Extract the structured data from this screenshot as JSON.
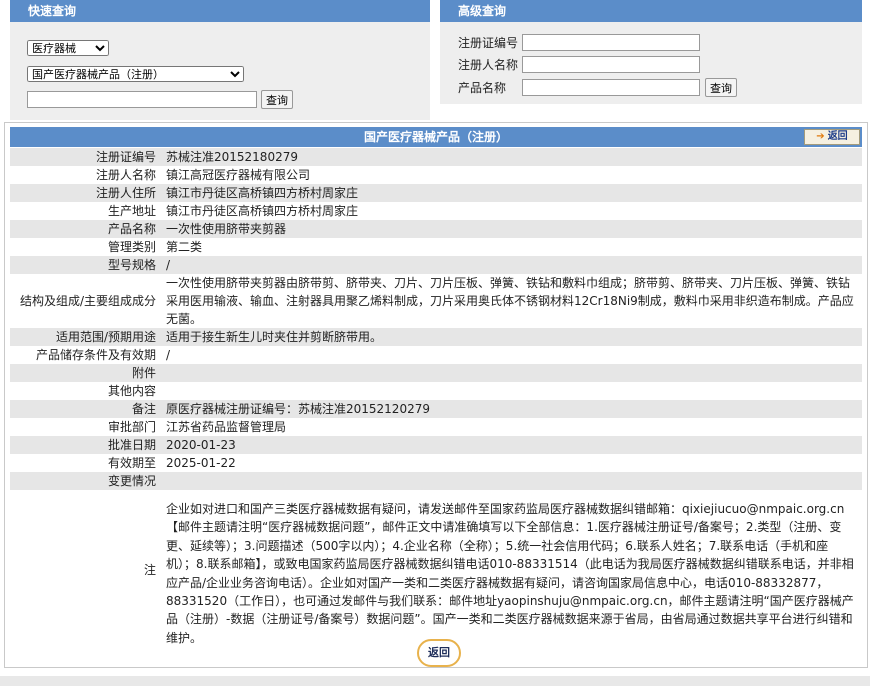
{
  "quick": {
    "title": "快速查询",
    "category_selected": "医疗器械",
    "product_type_selected": "国产医疗器械产品（注册）",
    "search_value": "",
    "query_button": "查询"
  },
  "advanced": {
    "title": "高级查询",
    "reg_no_label": "注册证编号",
    "registrant_label": "注册人名称",
    "product_name_label": "产品名称",
    "query_button": "查询"
  },
  "result": {
    "title": "国产医疗器械产品（注册）",
    "back_label": "返回",
    "bottom_back_label": "返回",
    "rows": [
      {
        "label": "注册证编号",
        "value": "苏械注准20152180279"
      },
      {
        "label": "注册人名称",
        "value": "镇江高冠医疗器械有限公司"
      },
      {
        "label": "注册人住所",
        "value": "镇江市丹徒区高桥镇四方桥村周家庄"
      },
      {
        "label": "生产地址",
        "value": "镇江市丹徒区高桥镇四方桥村周家庄"
      },
      {
        "label": "产品名称",
        "value": "一次性使用脐带夹剪器"
      },
      {
        "label": "管理类别",
        "value": "第二类"
      },
      {
        "label": "型号规格",
        "value": "/"
      },
      {
        "label": "结构及组成/主要组成成分",
        "value": "一次性使用脐带夹剪器由脐带剪、脐带夹、刀片、刀片压板、弹簧、铁钻和敷料巾组成；脐带剪、脐带夹、刀片压板、弹簧、铁钻采用医用输液、输血、注射器具用聚乙烯料制成，刀片采用奥氏体不锈钢材料12Cr18Ni9制成，敷料巾采用非织造布制成。产品应无菌。"
      },
      {
        "label": "适用范围/预期用途",
        "value": "适用于接生新生儿时夹住并剪断脐带用。"
      },
      {
        "label": "产品储存条件及有效期",
        "value": "/"
      },
      {
        "label": "附件",
        "value": ""
      },
      {
        "label": "其他内容",
        "value": ""
      },
      {
        "label": "备注",
        "value": "原医疗器械注册证编号：苏械注准20152120279"
      },
      {
        "label": "审批部门",
        "value": "江苏省药品监督管理局"
      },
      {
        "label": "批准日期",
        "value": "2020-01-23"
      },
      {
        "label": "有效期至",
        "value": "2025-01-22"
      },
      {
        "label": "变更情况",
        "value": ""
      }
    ],
    "notice_label": "注",
    "notice_text": "企业如对进口和国产三类医疗器械数据有疑问，请发送邮件至国家药监局医疗器械数据纠错邮箱：qixiejiucuo@nmpaic.org.cn【邮件主题请注明“医疗器械数据问题”，邮件正文中请准确填写以下全部信息：1.医疗器械注册证号/备案号；2.类型（注册、变更、延续等）；3.问题描述（500字以内）；4.企业名称（全称）；5.统一社会信用代码；6.联系人姓名；7.联系电话（手机和座机）；8.联系邮箱】，或致电国家药监局医疗器械数据纠错电话010-88331514（此电话为我局医疗器械数据纠错联系电话，并非相应产品/企业业务咨询电话）。企业如对国产一类和二类医疗器械数据有疑问，请咨询国家局信息中心，电话010-88332877，88331520（工作日），也可通过发邮件与我们联系：邮件地址yaopinshuju@nmpaic.org.cn，邮件主题请注明“国产医疗器械产品（注册）-数据（注册证号/备案号）数据问题”。国产一类和二类医疗器械数据来源于省局，由省局通过数据共享平台进行纠错和维护。"
  }
}
